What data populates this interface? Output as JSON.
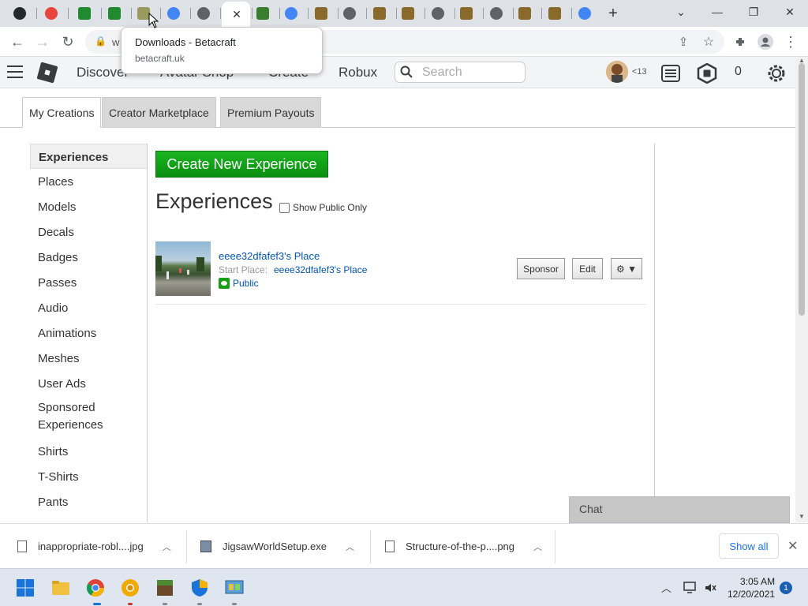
{
  "browser": {
    "tabs": [
      {
        "icon": "github-icon",
        "color": "#24292f"
      },
      {
        "icon": "chrome-icon",
        "color": "#e8453c"
      },
      {
        "icon": "roblox-green-icon",
        "color": "#1f8a2e"
      },
      {
        "icon": "roblox-green-icon",
        "color": "#1f8a2e"
      },
      {
        "icon": "betacraft-icon",
        "color": "#9a9a60"
      },
      {
        "icon": "google-icon",
        "color": "#4285f4"
      },
      {
        "icon": "globe-icon",
        "color": "#5f6368"
      },
      {
        "icon": "active-tab",
        "color": "#ffffff"
      },
      {
        "icon": "minecraft-icon",
        "color": "#3a7d2e"
      },
      {
        "icon": "google-icon",
        "color": "#4285f4"
      },
      {
        "icon": "cookie-icon",
        "color": "#8a6a2a"
      },
      {
        "icon": "chrome-dark-icon",
        "color": "#5f6368"
      },
      {
        "icon": "cookie-icon",
        "color": "#8a6a2a"
      },
      {
        "icon": "cookie-icon",
        "color": "#8a6a2a"
      },
      {
        "icon": "chrome-dark-icon",
        "color": "#5f6368"
      },
      {
        "icon": "cookie-icon",
        "color": "#8a6a2a"
      },
      {
        "icon": "chrome-dark-icon",
        "color": "#5f6368"
      },
      {
        "icon": "cookie-icon",
        "color": "#8a6a2a"
      },
      {
        "icon": "cookie-icon",
        "color": "#8a6a2a"
      },
      {
        "icon": "google-icon",
        "color": "#4285f4"
      }
    ],
    "active_tab_close": "✕",
    "new_tab": "+",
    "url_partial": "w",
    "tooltip": {
      "title": "Downloads - Betacraft",
      "url": "betacraft.uk"
    }
  },
  "roblox_nav": {
    "links": [
      "Discover",
      "Avatar Shop",
      "Create",
      "Robux"
    ],
    "search_placeholder": "Search",
    "age_badge": "<13",
    "robux_count": "0"
  },
  "content_tabs": [
    "My Creations",
    "Creator Marketplace",
    "Premium Payouts"
  ],
  "sidebar": [
    "Experiences",
    "Places",
    "Models",
    "Decals",
    "Badges",
    "Passes",
    "Audio",
    "Animations",
    "Meshes",
    "User Ads",
    "Sponsored Experiences",
    "Shirts",
    "T-Shirts",
    "Pants"
  ],
  "main": {
    "create_button": "Create New Experience",
    "heading": "Experiences",
    "show_public_label": "Show Public Only",
    "experience": {
      "name": "eeee32dfafef3's Place",
      "start_place_label": "Start Place:",
      "start_place_value": "eeee32dfafef3's Place",
      "status": "Public",
      "sponsor_label": "Sponsor",
      "edit_label": "Edit",
      "gear_label": "⚙ ▼"
    }
  },
  "chat": {
    "label": "Chat"
  },
  "downloads": {
    "items": [
      "inappropriate-robl....jpg",
      "JigsawWorldSetup.exe",
      "Structure-of-the-p....png"
    ],
    "show_all": "Show all"
  },
  "taskbar": {
    "time": "3:05 AM",
    "date": "12/20/2021",
    "notifications": "1"
  }
}
